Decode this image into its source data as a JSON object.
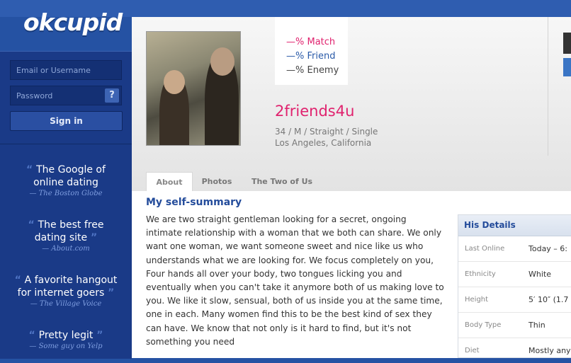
{
  "brand": {
    "logo_text": "okcupid"
  },
  "signin": {
    "username_placeholder": "Email or Username",
    "password_placeholder": "Password",
    "help_label": "?",
    "button_label": "Sign in"
  },
  "quotes": [
    {
      "text": "The Google of online dating",
      "source": "— The Boston Globe"
    },
    {
      "text": "The best free dating site",
      "source": "— About.com"
    },
    {
      "text": "A favorite hangout for internet goers",
      "source": "— The Village Voice"
    },
    {
      "text": "Pretty legit",
      "source": "— Some guy on Yelp"
    }
  ],
  "profile": {
    "match": "—% Match",
    "friend": "—% Friend",
    "enemy": "—% Enemy",
    "username": "2friends4u",
    "basics": "34 / M / Straight / Single",
    "location": "Los Angeles, California"
  },
  "tabs": [
    "About",
    "Photos",
    "The Two of Us"
  ],
  "summary": {
    "title": "My self-summary",
    "text": "We are two straight gentleman looking for a secret, ongoing intimate relationship with a woman that we both can share. We only want one woman, we want someone sweet and nice like us who understands what we are looking for. We focus completely on you, Four hands all over your body, two tongues licking you and eventually when you can't take it anymore both of us making love to you. We like it slow, sensual, both of us inside you at the same time, one in each. Many women find this to be the best kind of sex they can have. We know that not only is it hard to find, but it's not something you need"
  },
  "details": {
    "title": "His Details",
    "rows": [
      {
        "label": "Last Online",
        "value": "Today – 6:"
      },
      {
        "label": "Ethnicity",
        "value": "White"
      },
      {
        "label": "Height",
        "value": "5′ 10″ (1.7"
      },
      {
        "label": "Body Type",
        "value": "Thin"
      },
      {
        "label": "Diet",
        "value": "Mostly any"
      }
    ]
  },
  "colors": {
    "brand_blue": "#2552a3",
    "sidebar": "#1a3a87",
    "username_pink": "#e0226e",
    "match_red": "#e0226e",
    "friend_blue": "#2a5aa8",
    "enemy_gray": "#444444"
  }
}
